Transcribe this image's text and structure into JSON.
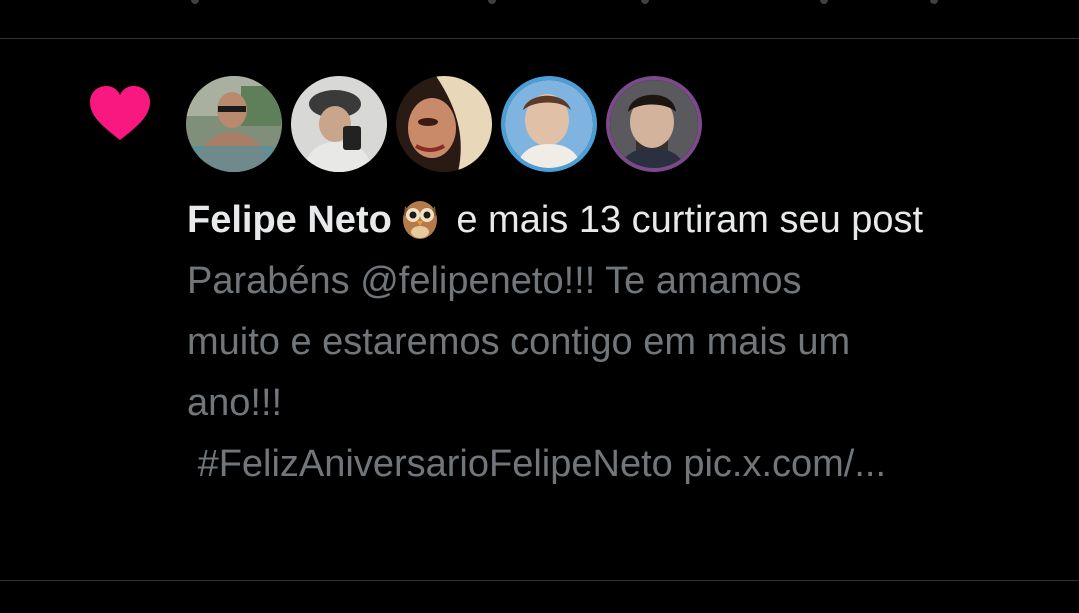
{
  "notification": {
    "type_icon": "heart-icon",
    "accent_color": "#f91880",
    "liker_name": "Felipe Neto",
    "liker_badge_icon": "owl-emoji-icon",
    "action_text": " e mais 13 curtiram seu post",
    "post_text_line1": "Parabéns @felipeneto!!! Te amamos",
    "post_text_line2": "muito e estaremos contigo em mais um",
    "post_text_line3": "ano!!!",
    "post_text_line4": " #FelizAniversarioFelipeNeto pic.x.com/...",
    "avatars": [
      {
        "name": "avatar-1",
        "icon": "user-photo"
      },
      {
        "name": "avatar-2",
        "icon": "user-photo"
      },
      {
        "name": "avatar-3",
        "icon": "user-photo"
      },
      {
        "name": "avatar-4",
        "icon": "user-photo"
      },
      {
        "name": "avatar-5",
        "icon": "user-photo"
      }
    ]
  },
  "colors": {
    "background": "#000000",
    "primary_text": "#e7e9ea",
    "secondary_text": "#71767b",
    "divider": "#2f3336"
  }
}
